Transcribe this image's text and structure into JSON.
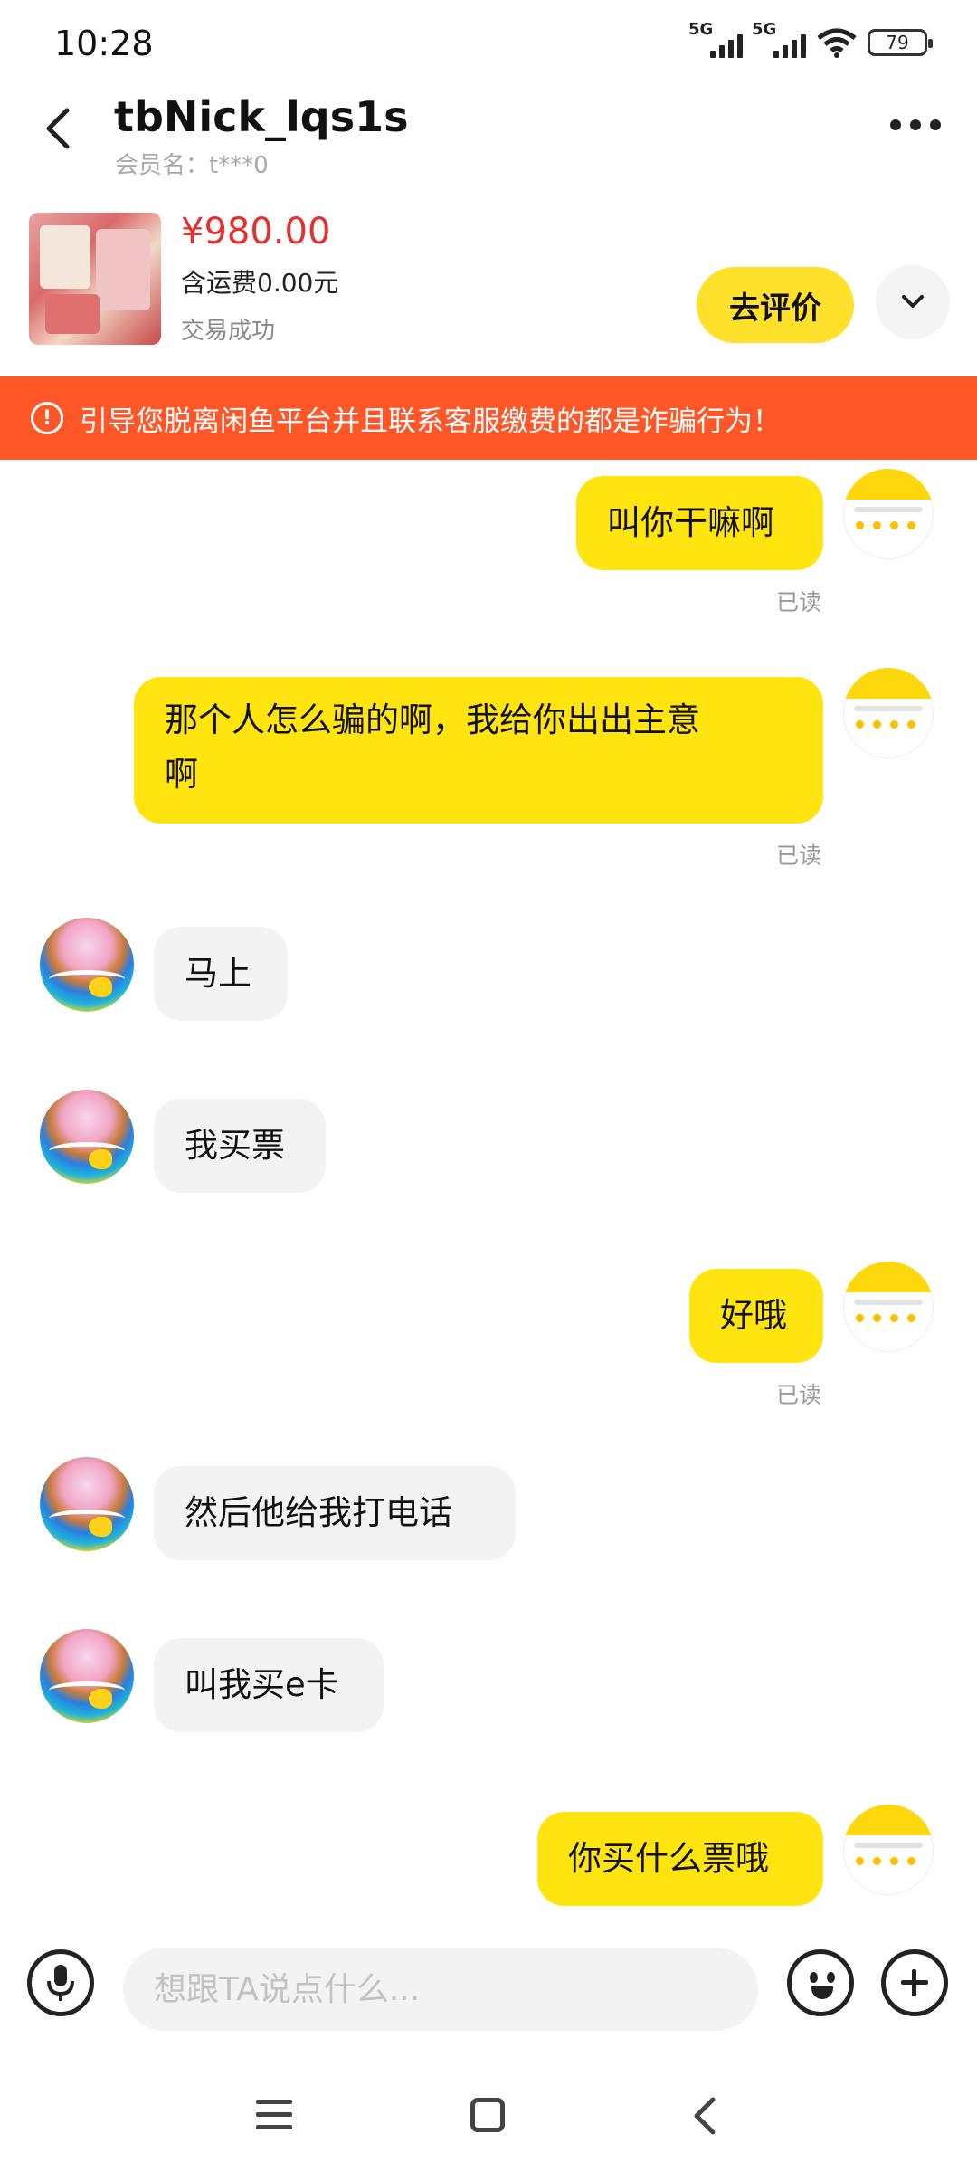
{
  "status_bar": {
    "time": "10:28",
    "signal1_label": "5G",
    "signal2_label": "5G",
    "battery": "79"
  },
  "header": {
    "nickname": "tbNick_lqs1s",
    "member_name": "会员名：t***0"
  },
  "product": {
    "price": "¥980.00",
    "shipping": "含运费0.00元",
    "status": "交易成功",
    "review_button": "去评价"
  },
  "warning": {
    "text": "引导您脱离闲鱼平台并且联系客服缴费的都是诈骗行为！"
  },
  "messages": [
    {
      "side": "out",
      "text": "叫你干嘛啊",
      "read": "已读"
    },
    {
      "side": "out",
      "text": "那个人怎么骗的啊，我给你出出主意啊",
      "line1": "那个人怎么骗的啊，我给你出出主意",
      "line2": "啊",
      "read": "已读"
    },
    {
      "side": "in",
      "text": "马上"
    },
    {
      "side": "in",
      "text": "我买票"
    },
    {
      "side": "out",
      "text": "好哦",
      "read": "已读"
    },
    {
      "side": "in",
      "text": "然后他给我打电话"
    },
    {
      "side": "in",
      "text": "叫我买e卡"
    },
    {
      "side": "out",
      "text": "你买什么票哦"
    }
  ],
  "input": {
    "placeholder": "想跟TA说点什么..."
  },
  "colors": {
    "accent_yellow": "#ffe40f",
    "warning_orange": "#ff5727",
    "price_red": "#e5302f"
  },
  "icons": [
    "back-arrow-icon",
    "more-dots-icon",
    "chevron-down-icon",
    "warning-circle-icon",
    "microphone-icon",
    "emoji-icon",
    "plus-icon",
    "menu-icon",
    "home-icon",
    "back-icon"
  ]
}
